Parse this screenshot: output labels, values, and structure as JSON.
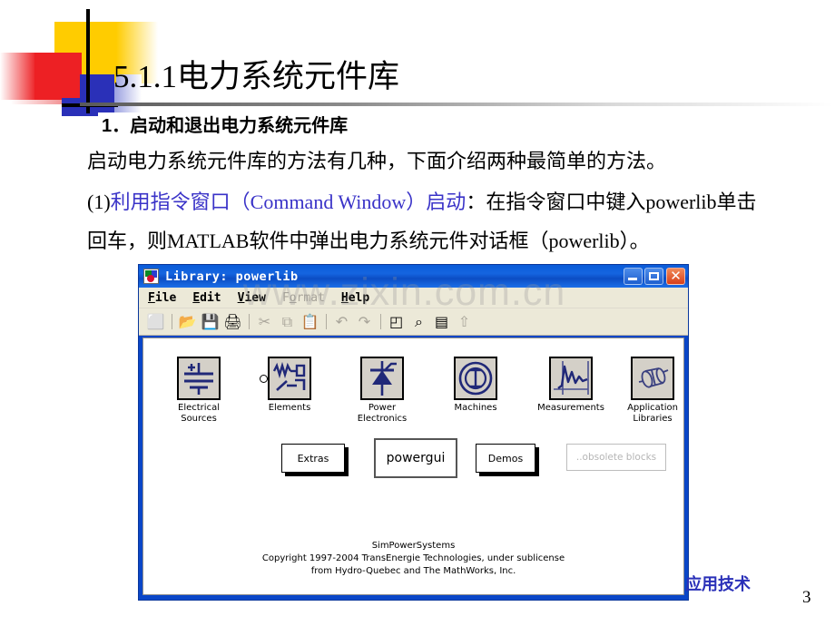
{
  "slide": {
    "title": "5.1.1电力系统元件库",
    "page_number": "3",
    "footer_brand": "应用技术",
    "watermark": "www.zixin.com.cn"
  },
  "body": {
    "heading": "1．启动和退出电力系统元件库",
    "line1": "启动电力系统元件库的方法有几种，下面介绍两种最简单的方法。",
    "line2_prefix": "(1)",
    "line2_blue": "利用指令窗口（Command Window）启动",
    "line2_rest": "：在指令窗口中键入powerlib单击",
    "line3": "回车，则MATLAB软件中弹出电力系统元件对话框（powerlib）。"
  },
  "window": {
    "title": "Library: powerlib",
    "icon_name": "simulink-icon",
    "buttons": {
      "minimize": "minimize",
      "maximize": "maximize",
      "close": "close"
    },
    "menu": [
      {
        "label": "File",
        "accel": "F",
        "disabled": false
      },
      {
        "label": "Edit",
        "accel": "E",
        "disabled": false
      },
      {
        "label": "View",
        "accel": "V",
        "disabled": false
      },
      {
        "label": "Format",
        "accel": "o",
        "disabled": true
      },
      {
        "label": "Help",
        "accel": "H",
        "disabled": false
      }
    ],
    "toolbar": [
      {
        "name": "new-model-icon",
        "glyph": "⬜",
        "dim": false
      },
      {
        "sep": true
      },
      {
        "name": "open-model-icon",
        "glyph": "📂",
        "dim": false
      },
      {
        "name": "save-icon",
        "glyph": "💾",
        "dim": false
      },
      {
        "name": "print-icon",
        "glyph": "🖨",
        "dim": false
      },
      {
        "sep": true
      },
      {
        "name": "cut-icon",
        "glyph": "✂",
        "dim": true
      },
      {
        "name": "copy-icon",
        "glyph": "⧉",
        "dim": true
      },
      {
        "name": "paste-icon",
        "glyph": "📋",
        "dim": true
      },
      {
        "sep": true
      },
      {
        "name": "undo-icon",
        "glyph": "↶",
        "dim": true
      },
      {
        "name": "redo-icon",
        "glyph": "↷",
        "dim": true
      },
      {
        "sep": true
      },
      {
        "name": "library-browser-icon",
        "glyph": "◰",
        "dim": false
      },
      {
        "name": "find-icon",
        "glyph": "⌕",
        "dim": false
      },
      {
        "name": "model-explorer-icon",
        "glyph": "▤",
        "dim": false
      },
      {
        "name": "go-up-icon",
        "glyph": "⇧",
        "dim": true
      }
    ],
    "blocks": [
      {
        "label": "Electrical\nSources",
        "icon": "voltage-source-icon",
        "has_port": false
      },
      {
        "label": "Elements",
        "icon": "rlc-elements-icon",
        "has_port": true
      },
      {
        "label": "Power\nElectronics",
        "icon": "thyristor-icon",
        "has_port": false
      },
      {
        "label": "Machines",
        "icon": "machine-icon",
        "has_port": false
      },
      {
        "label": "Measurements",
        "icon": "scope-waveform-icon",
        "has_port": false
      },
      {
        "label": "Application\nLibraries",
        "icon": "motor-icon",
        "has_port": false
      }
    ],
    "subsystems": [
      {
        "label": "Extras",
        "style": "shadow"
      },
      {
        "label": "powergui",
        "style": "thick"
      },
      {
        "label": "Demos",
        "style": "shadow"
      },
      {
        "label": "..obsolete blocks",
        "style": "ghost"
      }
    ],
    "canvas_footer": "SimPowerSystems\nCopyright  1997-2004 TransEnergie Technologies, under sublicense\nfrom Hydro-Quebec and The MathWorks, Inc."
  },
  "colors": {
    "accent_blue": "#2A30B8",
    "text_blue": "#3A33C8",
    "logo_yellow": "#FFCC00",
    "logo_red": "#ED2024",
    "window_blue": "#0A46C8",
    "block_gray": "#D4D0C8",
    "symbol_navy": "#202878"
  }
}
